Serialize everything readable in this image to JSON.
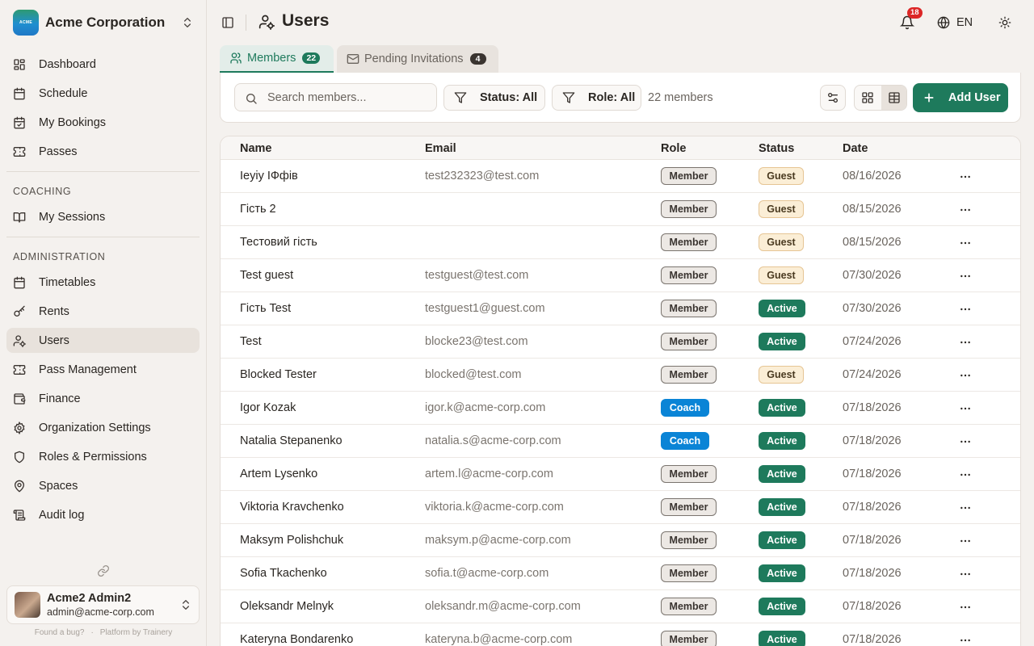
{
  "org": {
    "name": "Acme Corporation",
    "logo_text": "ACME"
  },
  "nav": {
    "main": [
      {
        "label": "Dashboard",
        "icon": "layout-dashboard-icon"
      },
      {
        "label": "Schedule",
        "icon": "calendar-icon"
      },
      {
        "label": "My Bookings",
        "icon": "calendar-check-icon"
      },
      {
        "label": "Passes",
        "icon": "ticket-icon"
      }
    ],
    "coaching_label": "COACHING",
    "coaching": [
      {
        "label": "My Sessions",
        "icon": "book-open-icon"
      }
    ],
    "admin_label": "ADMINISTRATION",
    "admin": [
      {
        "label": "Timetables",
        "icon": "calendar-icon"
      },
      {
        "label": "Rents",
        "icon": "key-icon"
      },
      {
        "label": "Users",
        "icon": "users-cog-icon"
      },
      {
        "label": "Pass Management",
        "icon": "ticket-icon"
      },
      {
        "label": "Finance",
        "icon": "wallet-icon"
      },
      {
        "label": "Organization Settings",
        "icon": "settings-icon"
      },
      {
        "label": "Roles & Permissions",
        "icon": "shield-icon"
      },
      {
        "label": "Spaces",
        "icon": "map-pin-icon"
      },
      {
        "label": "Audit log",
        "icon": "scroll-icon"
      }
    ],
    "active": "Users"
  },
  "user": {
    "name": "Acme2 Admin2",
    "email": "admin@acme-corp.com"
  },
  "footer": {
    "bug": "Found a bug?",
    "dot": "·",
    "platform": "Platform by Trainery"
  },
  "header": {
    "title": "Users",
    "notifications": "18",
    "lang": "EN"
  },
  "tabs": [
    {
      "label": "Members",
      "count": "22"
    },
    {
      "label": "Pending Invitations",
      "count": "4"
    }
  ],
  "toolbar": {
    "search_placeholder": "Search members...",
    "status_filter": "Status: All",
    "role_filter": "Role: All",
    "count": "22 members",
    "add_label": "Add User"
  },
  "table": {
    "headers": [
      "Name",
      "Email",
      "Role",
      "Status",
      "Date"
    ],
    "rows": [
      {
        "name": "Ieyiy IФфів",
        "email": "test232323@test.com",
        "role": "Member",
        "status": "Guest",
        "date": "08/16/2026"
      },
      {
        "name": "Гість 2",
        "email": "",
        "role": "Member",
        "status": "Guest",
        "date": "08/15/2026"
      },
      {
        "name": "Тестовий гість",
        "email": "",
        "role": "Member",
        "status": "Guest",
        "date": "08/15/2026"
      },
      {
        "name": "Test guest",
        "email": "testguest@test.com",
        "role": "Member",
        "status": "Guest",
        "date": "07/30/2026"
      },
      {
        "name": "Гість Test",
        "email": "testguest1@guest.com",
        "role": "Member",
        "status": "Active",
        "date": "07/30/2026"
      },
      {
        "name": "Test",
        "email": "blocke23@test.com",
        "role": "Member",
        "status": "Active",
        "date": "07/24/2026"
      },
      {
        "name": "Blocked Tester",
        "email": "blocked@test.com",
        "role": "Member",
        "status": "Guest",
        "date": "07/24/2026"
      },
      {
        "name": "Igor Kozak",
        "email": "igor.k@acme-corp.com",
        "role": "Coach",
        "status": "Active",
        "date": "07/18/2026"
      },
      {
        "name": "Natalia Stepanenko",
        "email": "natalia.s@acme-corp.com",
        "role": "Coach",
        "status": "Active",
        "date": "07/18/2026"
      },
      {
        "name": "Artem Lysenko",
        "email": "artem.l@acme-corp.com",
        "role": "Member",
        "status": "Active",
        "date": "07/18/2026"
      },
      {
        "name": "Viktoria Kravchenko",
        "email": "viktoria.k@acme-corp.com",
        "role": "Member",
        "status": "Active",
        "date": "07/18/2026"
      },
      {
        "name": "Maksym Polishchuk",
        "email": "maksym.p@acme-corp.com",
        "role": "Member",
        "status": "Active",
        "date": "07/18/2026"
      },
      {
        "name": "Sofia Tkachenko",
        "email": "sofia.t@acme-corp.com",
        "role": "Member",
        "status": "Active",
        "date": "07/18/2026"
      },
      {
        "name": "Oleksandr Melnyk",
        "email": "oleksandr.m@acme-corp.com",
        "role": "Member",
        "status": "Active",
        "date": "07/18/2026"
      },
      {
        "name": "Kateryna Bondarenko",
        "email": "kateryna.b@acme-corp.com",
        "role": "Member",
        "status": "Active",
        "date": "07/18/2026"
      }
    ]
  },
  "colors": {
    "primary": "#1e7a5c",
    "coach": "#0a84d6",
    "guest_bg": "#fbeed6",
    "danger": "#dc2626"
  }
}
